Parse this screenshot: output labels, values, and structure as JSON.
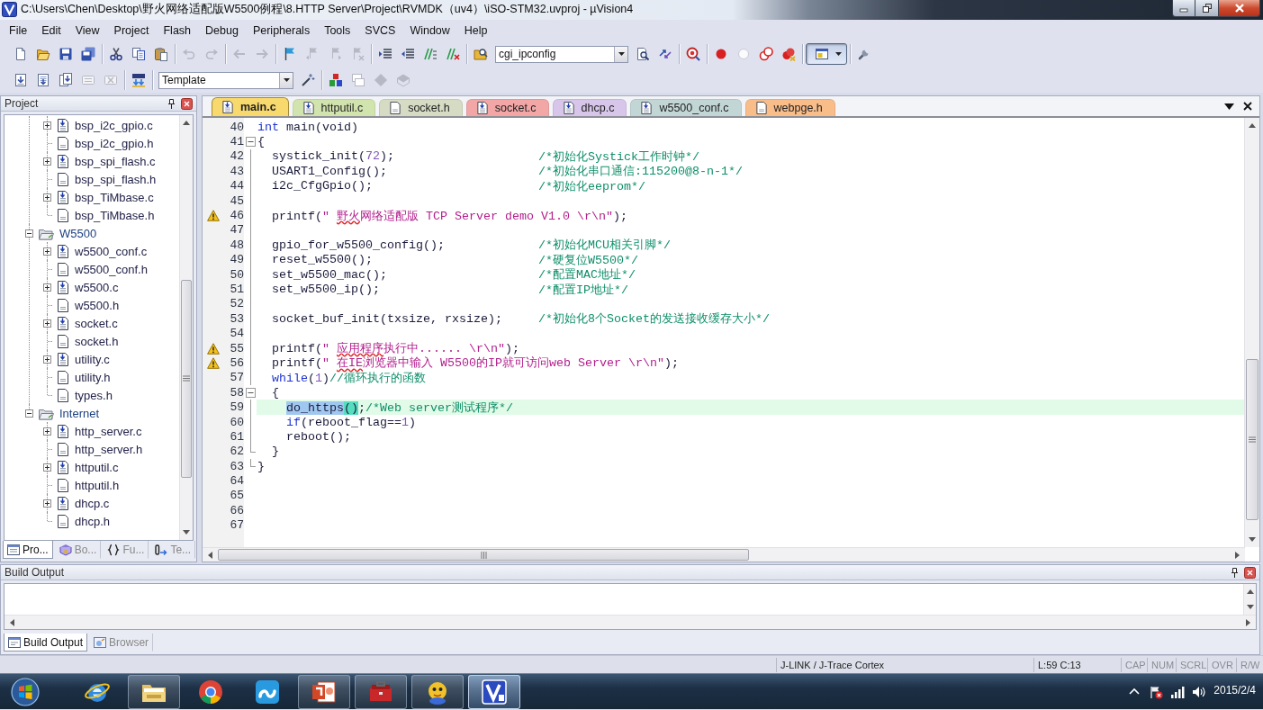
{
  "window": {
    "title": "C:\\Users\\Chen\\Desktop\\野火网络适配版W5500例程\\8.HTTP Server\\Project\\RVMDK（uv4）\\iSO-STM32.uvproj - µVision4"
  },
  "menu": [
    "File",
    "Edit",
    "View",
    "Project",
    "Flash",
    "Debug",
    "Peripherals",
    "Tools",
    "SVCS",
    "Window",
    "Help"
  ],
  "toolbar_1": [
    {
      "items": [
        {
          "kind": "new",
          "disabled": false,
          "pressed": false
        },
        {
          "kind": "open",
          "disabled": false,
          "pressed": false
        },
        {
          "kind": "save",
          "disabled": false,
          "pressed": false
        },
        {
          "kind": "save-all",
          "disabled": false,
          "pressed": false
        }
      ]
    },
    {
      "items": [
        {
          "kind": "cut",
          "disabled": false,
          "pressed": false
        },
        {
          "kind": "copy",
          "disabled": false,
          "pressed": false
        },
        {
          "kind": "paste",
          "disabled": false,
          "pressed": false
        }
      ]
    },
    {
      "items": [
        {
          "kind": "undo",
          "disabled": true,
          "pressed": false
        },
        {
          "kind": "redo",
          "disabled": true,
          "pressed": false
        }
      ]
    },
    {
      "items": [
        {
          "kind": "back",
          "disabled": true,
          "pressed": false
        },
        {
          "kind": "forward",
          "disabled": true,
          "pressed": false
        }
      ]
    },
    {
      "items": [
        {
          "kind": "bookmark",
          "disabled": false,
          "pressed": false
        },
        {
          "kind": "bookmark-prev",
          "disabled": true,
          "pressed": false
        },
        {
          "kind": "bookmark-next",
          "disabled": true,
          "pressed": false
        },
        {
          "kind": "bookmark-clear",
          "disabled": true,
          "pressed": false
        }
      ]
    },
    {
      "items": [
        {
          "kind": "indent",
          "disabled": false,
          "pressed": false
        },
        {
          "kind": "outdent",
          "disabled": false,
          "pressed": false
        },
        {
          "kind": "comment",
          "disabled": false,
          "pressed": false
        },
        {
          "kind": "uncomment",
          "disabled": false,
          "pressed": false
        }
      ]
    },
    {
      "items": [
        {
          "kind": "find-files",
          "disabled": false,
          "pressed": false
        },
        {
          "kind": "combo",
          "value": "cgi_ipconfig",
          "disabled": false
        },
        {
          "kind": "find",
          "disabled": false,
          "pressed": false
        },
        {
          "kind": "find-next",
          "disabled": false,
          "pressed": false
        }
      ]
    },
    {
      "items": [
        {
          "kind": "debug",
          "disabled": false,
          "pressed": false
        }
      ]
    },
    {
      "items": [
        {
          "kind": "breakpoint",
          "disabled": false,
          "pressed": false
        },
        {
          "kind": "breakpoint-off",
          "disabled": false,
          "pressed": false
        },
        {
          "kind": "breakpoint-disable",
          "disabled": false,
          "pressed": false
        },
        {
          "kind": "breakpoint-kill",
          "disabled": false,
          "pressed": false
        }
      ]
    },
    {
      "items": [
        {
          "kind": "windows",
          "disabled": false,
          "pressed": true
        }
      ]
    },
    {
      "items": [
        {
          "kind": "configure",
          "disabled": false,
          "pressed": false
        }
      ]
    }
  ],
  "toolbar_2": [
    {
      "items": [
        {
          "kind": "translate",
          "disabled": false,
          "pressed": false
        },
        {
          "kind": "build",
          "disabled": false,
          "pressed": false
        },
        {
          "kind": "rebuild",
          "disabled": false,
          "pressed": false
        },
        {
          "kind": "batch",
          "disabled": true,
          "pressed": false
        },
        {
          "kind": "stop",
          "disabled": true,
          "pressed": false
        }
      ]
    },
    {
      "items": [
        {
          "kind": "download",
          "disabled": false,
          "pressed": false
        }
      ]
    },
    {
      "items": [
        {
          "kind": "combo",
          "value": "Template",
          "disabled": false
        },
        {
          "kind": "options",
          "disabled": false,
          "pressed": false
        }
      ]
    },
    {
      "items": [
        {
          "kind": "components",
          "disabled": false,
          "pressed": false
        },
        {
          "kind": "environment",
          "disabled": true,
          "pressed": false
        },
        {
          "kind": "device",
          "disabled": true,
          "pressed": false
        },
        {
          "kind": "books",
          "disabled": true,
          "pressed": false
        }
      ]
    }
  ],
  "project_panel": {
    "title": "Project",
    "tree": [
      {
        "kind": "folder",
        "children": [
          {
            "kind": "source",
            "label": "bsp_i2c_gpio.c",
            "expanded": false
          },
          {
            "kind": "header",
            "label": "bsp_i2c_gpio.h"
          },
          {
            "kind": "source",
            "label": "bsp_spi_flash.c",
            "expanded": false
          },
          {
            "kind": "header",
            "label": "bsp_spi_flash.h"
          },
          {
            "kind": "source",
            "label": "bsp_TiMbase.c",
            "expanded": false
          },
          {
            "kind": "header",
            "label": "bsp_TiMbase.h"
          }
        ]
      },
      {
        "kind": "folder",
        "label": "W5500",
        "expanded": true,
        "children": [
          {
            "kind": "source",
            "label": "w5500_conf.c",
            "expanded": false
          },
          {
            "kind": "header",
            "label": "w5500_conf.h"
          },
          {
            "kind": "source",
            "label": "w5500.c",
            "expanded": false
          },
          {
            "kind": "header",
            "label": "w5500.h"
          },
          {
            "kind": "source",
            "label": "socket.c",
            "expanded": false
          },
          {
            "kind": "header",
            "label": "socket.h"
          },
          {
            "kind": "source",
            "label": "utility.c",
            "expanded": false
          },
          {
            "kind": "header",
            "label": "utility.h"
          },
          {
            "kind": "header",
            "label": "types.h"
          }
        ]
      },
      {
        "kind": "folder",
        "label": "Internet",
        "expanded": true,
        "children": [
          {
            "kind": "source",
            "label": "http_server.c",
            "expanded": false
          },
          {
            "kind": "header",
            "label": "http_server.h"
          },
          {
            "kind": "source",
            "label": "httputil.c",
            "expanded": false
          },
          {
            "kind": "header",
            "label": "httputil.h"
          },
          {
            "kind": "source",
            "label": "dhcp.c",
            "expanded": false
          },
          {
            "kind": "header",
            "label": "dhcp.h"
          }
        ]
      }
    ],
    "tabs": [
      {
        "label": "Pro...",
        "kind": "project",
        "selected": true
      },
      {
        "label": "Bo...",
        "kind": "books",
        "selected": false
      },
      {
        "label": "Fu...",
        "kind": "functions",
        "selected": false
      },
      {
        "label": "Te...",
        "kind": "templates",
        "selected": false
      }
    ]
  },
  "editor": {
    "tabs": [
      {
        "label": "main.c",
        "kind": "source",
        "selected": true,
        "color": "#f8d96e"
      },
      {
        "label": "httputil.c",
        "kind": "source",
        "selected": false,
        "color": "#d2e4ae"
      },
      {
        "label": "socket.h",
        "kind": "header",
        "selected": false,
        "color": "#d6dcc4"
      },
      {
        "label": "socket.c",
        "kind": "source",
        "selected": false,
        "color": "#f2a6a6"
      },
      {
        "label": "dhcp.c",
        "kind": "source",
        "selected": false,
        "color": "#d8c6ea"
      },
      {
        "label": "w5500_conf.c",
        "kind": "source",
        "selected": false,
        "color": "#c3d6d6"
      },
      {
        "label": "webpge.h",
        "kind": "header",
        "selected": false,
        "color": "#f9bd8a"
      }
    ],
    "lines": [
      {
        "number": "40",
        "kind": "outside",
        "warning": false,
        "current": false,
        "code": [
          {
            "kind": "keyword",
            "text": "int"
          },
          {
            "kind": "plain",
            "text": " main(void)"
          }
        ]
      },
      {
        "number": "41",
        "kind": "opener",
        "warning": false,
        "current": false,
        "code": [
          {
            "kind": "plain",
            "text": "{"
          }
        ]
      },
      {
        "number": "42",
        "kind": "body",
        "warning": false,
        "current": false,
        "code": [
          {
            "kind": "plain",
            "text": "  systick_init("
          },
          {
            "kind": "number",
            "text": "72"
          },
          {
            "kind": "plain",
            "text": ");"
          }
        ],
        "comment": "/*初始化Systick工作时钟*/"
      },
      {
        "number": "43",
        "kind": "body",
        "warning": false,
        "current": false,
        "code": [
          {
            "kind": "plain",
            "text": "  USART1_Config();"
          }
        ],
        "comment": "/*初始化串口通信:115200@8-n-1*/"
      },
      {
        "number": "44",
        "kind": "body",
        "warning": false,
        "current": false,
        "code": [
          {
            "kind": "plain",
            "text": "  i2c_CfgGpio();"
          }
        ],
        "comment": "/*初始化eeprom*/"
      },
      {
        "number": "45",
        "kind": "body",
        "warning": false,
        "current": false
      },
      {
        "number": "46",
        "kind": "body",
        "warning": true,
        "current": false,
        "code": [
          {
            "kind": "plain",
            "text": "  printf("
          },
          {
            "kind": "string",
            "text": "\" "
          },
          {
            "kind": "flagged",
            "text": "野火"
          },
          {
            "kind": "string",
            "text": "网络适配版 TCP Server demo V1.0 \\r\\n\""
          },
          {
            "kind": "plain",
            "text": ");"
          }
        ]
      },
      {
        "number": "47",
        "kind": "body",
        "warning": false,
        "current": false
      },
      {
        "number": "48",
        "kind": "body",
        "warning": false,
        "current": false,
        "code": [
          {
            "kind": "plain",
            "text": "  gpio_for_w5500_config();"
          }
        ],
        "comment": "/*初始化MCU相关引脚*/"
      },
      {
        "number": "49",
        "kind": "body",
        "warning": false,
        "current": false,
        "code": [
          {
            "kind": "plain",
            "text": "  reset_w5500();"
          }
        ],
        "comment": "/*硬复位W5500*/"
      },
      {
        "number": "50",
        "kind": "body",
        "warning": false,
        "current": false,
        "code": [
          {
            "kind": "plain",
            "text": "  set_w5500_mac();"
          }
        ],
        "comment": "/*配置MAC地址*/"
      },
      {
        "number": "51",
        "kind": "body",
        "warning": false,
        "current": false,
        "code": [
          {
            "kind": "plain",
            "text": "  set_w5500_ip();"
          }
        ],
        "comment": "/*配置IP地址*/"
      },
      {
        "number": "52",
        "kind": "body",
        "warning": false,
        "current": false
      },
      {
        "number": "53",
        "kind": "body",
        "warning": false,
        "current": false,
        "code": [
          {
            "kind": "plain",
            "text": "  socket_buf_init(txsize, rxsize);"
          }
        ],
        "comment": "/*初始化8个Socket的发送接收缓存大小*/"
      },
      {
        "number": "54",
        "kind": "body",
        "warning": false,
        "current": false
      },
      {
        "number": "55",
        "kind": "body",
        "warning": true,
        "current": false,
        "code": [
          {
            "kind": "plain",
            "text": "  printf("
          },
          {
            "kind": "string",
            "text": "\" "
          },
          {
            "kind": "flagged",
            "text": "应用程序"
          },
          {
            "kind": "string",
            "text": "执行中...... \\r\\n\""
          },
          {
            "kind": "plain",
            "text": ");"
          }
        ]
      },
      {
        "number": "56",
        "kind": "body",
        "warning": true,
        "current": false,
        "code": [
          {
            "kind": "plain",
            "text": "  printf("
          },
          {
            "kind": "string",
            "text": "\" "
          },
          {
            "kind": "flagged",
            "text": "在IE"
          },
          {
            "kind": "string",
            "text": "浏览器中输入 W5500的IP就可访问web Server \\r\\n\""
          },
          {
            "kind": "plain",
            "text": ");"
          }
        ]
      },
      {
        "number": "57",
        "kind": "body",
        "warning": false,
        "current": false,
        "code": [
          {
            "kind": "keyword",
            "text": "  while"
          },
          {
            "kind": "plain",
            "text": "("
          },
          {
            "kind": "number",
            "text": "1"
          },
          {
            "kind": "plain",
            "text": ")"
          },
          {
            "kind": "comment",
            "text": "//循环执行的函数"
          }
        ]
      },
      {
        "number": "58",
        "kind": "opener",
        "warning": false,
        "current": false,
        "code": [
          {
            "kind": "plain",
            "text": "  {"
          }
        ]
      },
      {
        "number": "59",
        "kind": "body",
        "warning": false,
        "current": true,
        "code": [
          {
            "kind": "selected",
            "text": "    do_https"
          },
          {
            "kind": "brace",
            "text": "()"
          },
          {
            "kind": "plain",
            "text": ";"
          },
          {
            "kind": "comment",
            "text": "/*Web server测试程序*/"
          }
        ]
      },
      {
        "number": "60",
        "kind": "body",
        "warning": false,
        "current": false,
        "code": [
          {
            "kind": "keyword",
            "text": "    if"
          },
          {
            "kind": "plain",
            "text": "(reboot_flag=="
          },
          {
            "kind": "number",
            "text": "1"
          },
          {
            "kind": "plain",
            "text": ")"
          }
        ]
      },
      {
        "number": "61",
        "kind": "body",
        "warning": false,
        "current": false,
        "code": [
          {
            "kind": "plain",
            "text": "    reboot();"
          }
        ]
      },
      {
        "number": "62",
        "kind": "closer",
        "warning": false,
        "current": false,
        "code": [
          {
            "kind": "plain",
            "text": "  }"
          }
        ]
      },
      {
        "number": "63",
        "kind": "closer",
        "warning": false,
        "current": false,
        "code": [
          {
            "kind": "plain",
            "text": "}"
          }
        ]
      },
      {
        "number": "64",
        "kind": "outside",
        "warning": false,
        "current": false
      },
      {
        "number": "65",
        "kind": "outside",
        "warning": false,
        "current": false
      },
      {
        "number": "66",
        "kind": "outside",
        "warning": false,
        "current": false
      },
      {
        "number": "67",
        "kind": "outside",
        "warning": false,
        "current": false
      }
    ]
  },
  "build_output": {
    "title": "Build Output",
    "tabs": [
      {
        "label": "Build Output",
        "kind": "output",
        "selected": true
      },
      {
        "label": "Browser",
        "kind": "browser",
        "selected": false
      }
    ]
  },
  "status_bar": {
    "target": "J-LINK / J-Trace Cortex",
    "position": "L:59 C:13",
    "indicators": [
      {
        "label": "CAP",
        "on": false
      },
      {
        "label": "NUM",
        "on": false
      },
      {
        "label": "SCRL",
        "on": false
      },
      {
        "label": "OVR",
        "on": false
      },
      {
        "label": "R/W",
        "on": false
      }
    ]
  },
  "taskbar": {
    "apps": [
      {
        "kind": "browser",
        "running": false,
        "selected": false
      },
      {
        "kind": "files",
        "running": true,
        "selected": false
      },
      {
        "kind": "web",
        "running": false,
        "selected": false
      },
      {
        "kind": "cloud",
        "running": false,
        "selected": false
      },
      {
        "kind": "slides",
        "running": true,
        "selected": false
      },
      {
        "kind": "toolbox",
        "running": true,
        "selected": false
      },
      {
        "kind": "mascot",
        "running": true,
        "selected": false
      },
      {
        "kind": "ide",
        "running": true,
        "selected": true
      }
    ],
    "date": "2015/2/4"
  }
}
